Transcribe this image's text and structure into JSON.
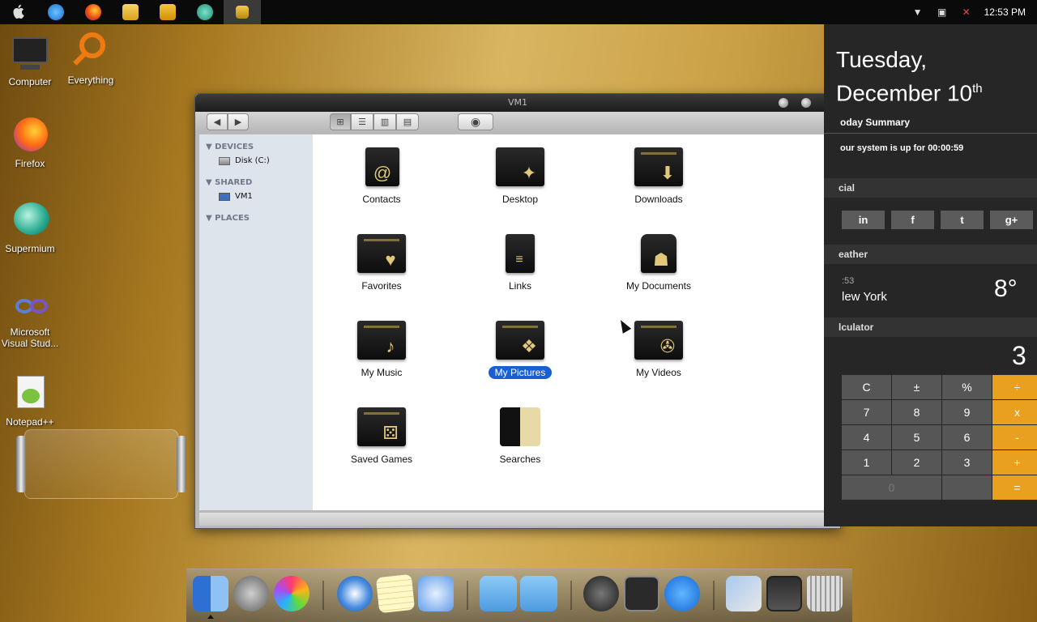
{
  "topbar": {
    "clock": "12:53 PM"
  },
  "desktop": {
    "icons": [
      {
        "label": "Computer"
      },
      {
        "label": "Everything"
      },
      {
        "label": "Firefox"
      },
      {
        "label": "Supermium"
      },
      {
        "label": "Microsoft Visual Stud..."
      },
      {
        "label": "Notepad++"
      }
    ]
  },
  "window": {
    "title": "VM1",
    "sidebar": {
      "sections": [
        {
          "heading": "DEVICES",
          "items": [
            "Disk (C:)"
          ]
        },
        {
          "heading": "SHARED",
          "items": [
            "VM1"
          ]
        },
        {
          "heading": "PLACES",
          "items": []
        }
      ]
    },
    "files": [
      {
        "label": "Contacts"
      },
      {
        "label": "Desktop"
      },
      {
        "label": "Downloads"
      },
      {
        "label": "Favorites"
      },
      {
        "label": "Links"
      },
      {
        "label": "My Documents"
      },
      {
        "label": "My Music"
      },
      {
        "label": "My Pictures"
      },
      {
        "label": "My Videos"
      },
      {
        "label": "Saved Games"
      },
      {
        "label": "Searches"
      }
    ]
  },
  "panel": {
    "day": "Tuesday,",
    "date": "December 10",
    "date_suffix": "th",
    "today_summary": "oday Summary",
    "uptime": "our system is up for 00:00:59",
    "social_heading": "cial",
    "social": [
      "in",
      "f",
      "t",
      "g+"
    ],
    "weather_heading": "eather",
    "weather_time": ":53",
    "weather_city": "lew York",
    "weather_temp": "8°",
    "calc_heading": "lculator",
    "calc_display": "3",
    "calc_keys": [
      "C",
      "±",
      "%",
      "÷",
      "7",
      "8",
      "9",
      "x",
      "4",
      "5",
      "6",
      "-",
      "1",
      "2",
      "3",
      "+",
      "0",
      "",
      "="
    ]
  },
  "colors": {
    "accent_selection": "#1a5fd1",
    "calc_operator": "#e9a01e"
  }
}
